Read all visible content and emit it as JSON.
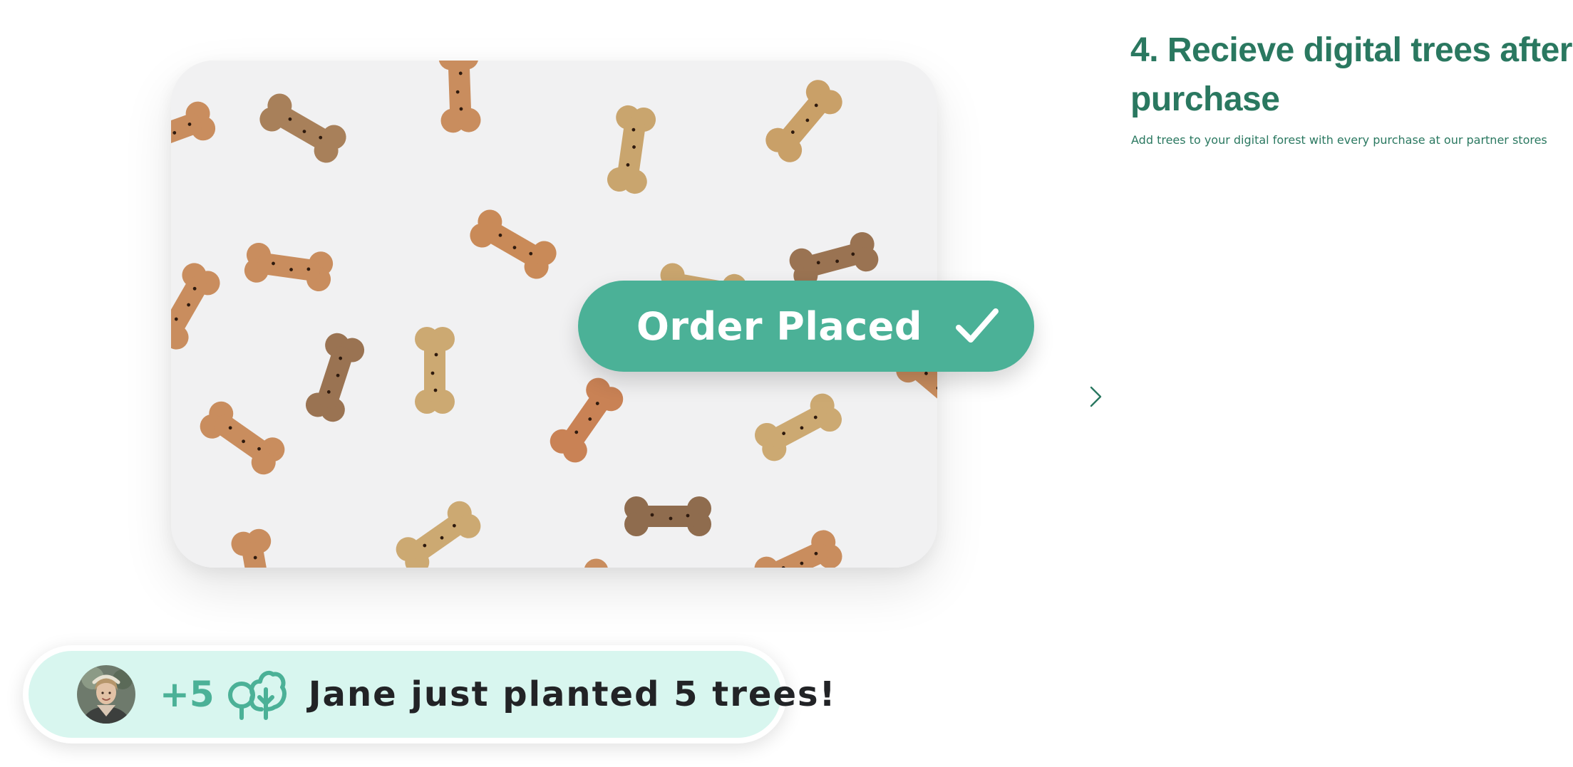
{
  "step": {
    "title": "4. Recieve digital trees after purchase",
    "description": "Add trees to your digital forest with every purchase at our partner stores"
  },
  "order_badge": {
    "label": "Order Placed",
    "icon": "checkmark-icon"
  },
  "navigation": {
    "next_icon": "chevron-right-icon"
  },
  "notification": {
    "count": "+5",
    "message": "Jane just planted 5 trees!",
    "icon": "trees-icon"
  },
  "colors": {
    "brand_green": "#4bb197",
    "heading_green": "#2a7860",
    "notification_bg": "#d8f6ef",
    "text_dark": "#222326"
  }
}
